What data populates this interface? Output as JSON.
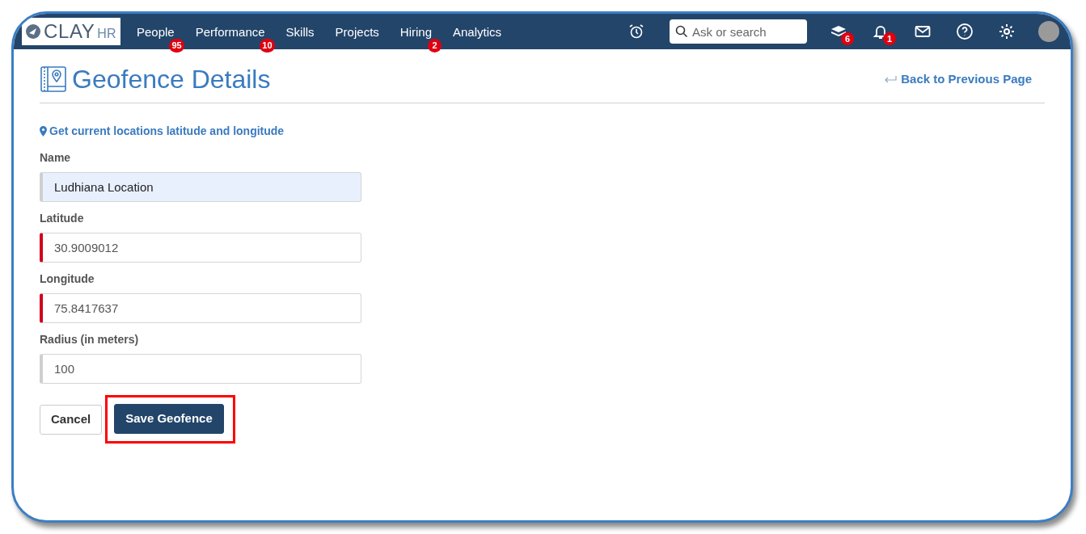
{
  "nav": {
    "logo": {
      "main": "CLAY",
      "sub": "HR"
    },
    "items": [
      {
        "label": "People",
        "badge": "95"
      },
      {
        "label": "Performance",
        "badge": "10"
      },
      {
        "label": "Skills"
      },
      {
        "label": "Projects"
      },
      {
        "label": "Hiring",
        "badge": "2"
      },
      {
        "label": "Analytics"
      }
    ],
    "search": {
      "placeholder": "Ask or search"
    },
    "icons": [
      {
        "kind": "alarm"
      },
      {
        "kind": "search"
      },
      {
        "kind": "layers",
        "badge": "6"
      },
      {
        "kind": "bell",
        "badge": "1"
      },
      {
        "kind": "mail"
      },
      {
        "kind": "help"
      },
      {
        "kind": "gear"
      },
      {
        "kind": "avatar"
      }
    ]
  },
  "page": {
    "title": "Geofence Details",
    "back_link": "Back to Previous Page",
    "location_link": "Get current locations latitude and longitude"
  },
  "fields": [
    {
      "label": "Name",
      "value": "Ludhiana Location",
      "autofilled": true,
      "invalid": false
    },
    {
      "label": "Latitude",
      "value": "30.9009012",
      "autofilled": false,
      "invalid": true
    },
    {
      "label": "Longitude",
      "value": "75.8417637",
      "autofilled": false,
      "invalid": true
    },
    {
      "label": "Radius (in meters)",
      "value": "100",
      "autofilled": false,
      "invalid": false
    }
  ],
  "buttons": [
    {
      "label": "Cancel",
      "kind": "secondary",
      "highlighted": false
    },
    {
      "label": "Save Geofence",
      "kind": "primary",
      "highlighted": true
    }
  ]
}
